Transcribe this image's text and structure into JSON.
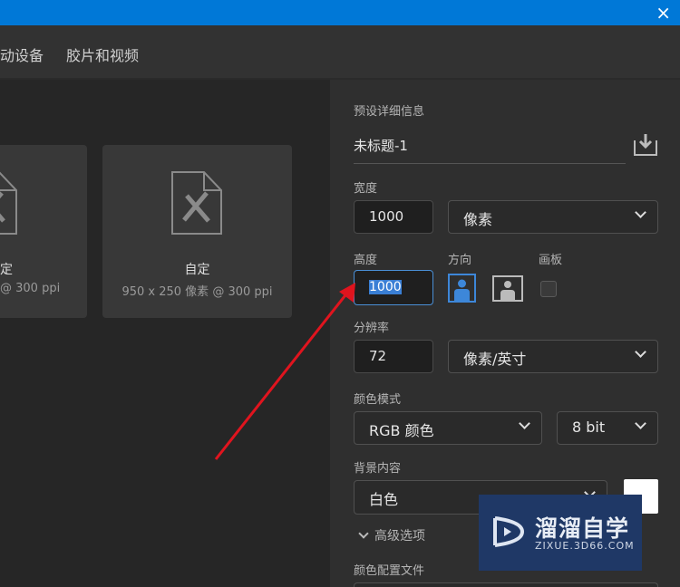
{
  "window": {
    "close_icon": "×"
  },
  "tabs": [
    "动设备",
    "胶片和视频"
  ],
  "presets": [
    {
      "name": "定",
      "size": "@ 300 ppi"
    },
    {
      "name": "自定",
      "size": "950 x 250 像素 @ 300 ppi"
    }
  ],
  "details": {
    "heading": "预设详细信息",
    "doc_name": "未标题-1",
    "width_label": "宽度",
    "width_value": "1000",
    "width_unit": "像素",
    "height_label": "高度",
    "height_value": "1000",
    "orientation_label": "方向",
    "artboard_label": "画板",
    "resolution_label": "分辨率",
    "resolution_value": "72",
    "resolution_unit": "像素/英寸",
    "color_mode_label": "颜色模式",
    "color_mode": "RGB 颜色",
    "bit_depth": "8 bit",
    "background_label": "背景内容",
    "background": "白色",
    "advanced_label": "高级选项",
    "color_profile_label": "颜色配置文件"
  },
  "watermark": {
    "title": "溜溜自学",
    "url": "ZIXUE.3D66.COM"
  },
  "colors": {
    "accent": "#0078d7",
    "arrow": "#e0141e"
  }
}
